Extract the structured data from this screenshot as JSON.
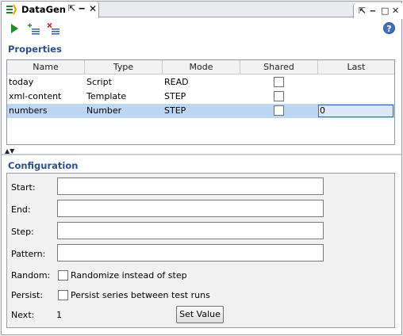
{
  "tab": {
    "title": "DataGen",
    "icon": "datagen-icon",
    "pin_glyph": "⇱",
    "minimize_glyph": "‒",
    "close_glyph": "✕"
  },
  "window_controls": {
    "pin_glyph": "⇱",
    "minimize_glyph": "‒",
    "maximize_glyph": "□",
    "close_glyph": "✕"
  },
  "toolbar": {
    "run_icon": "play-icon",
    "add_icon": "add-property-icon",
    "delete_icon": "delete-property-icon",
    "help_label": "?"
  },
  "properties": {
    "title": "Properties",
    "columns": [
      "Name",
      "Type",
      "Mode",
      "Shared",
      "Last"
    ],
    "rows": [
      {
        "name": "today",
        "type": "Script",
        "mode": "READ",
        "shared": false,
        "last": ""
      },
      {
        "name": "xml-content",
        "type": "Template",
        "mode": "STEP",
        "shared": false,
        "last": ""
      },
      {
        "name": "numbers",
        "type": "Number",
        "mode": "STEP",
        "shared": false,
        "last": "0",
        "selected": true
      }
    ],
    "splitter_glyph": "▲▼"
  },
  "configuration": {
    "title": "Configuration",
    "start_label": "Start:",
    "start_value": "",
    "end_label": "End:",
    "end_value": "",
    "step_label": "Step:",
    "step_value": "",
    "pattern_label": "Pattern:",
    "pattern_value": "",
    "random_label": "Random:",
    "random_text": "Randomize instead of step",
    "persist_label": "Persist:",
    "persist_text": "Persist series between test runs",
    "next_label": "Next:",
    "next_value": "1",
    "set_value_label": "Set Value"
  },
  "colors": {
    "section_title": "#2d4f86",
    "selection": "#bcd7f3",
    "run_green": "#1f8f2a",
    "help_blue": "#3f70c5"
  }
}
